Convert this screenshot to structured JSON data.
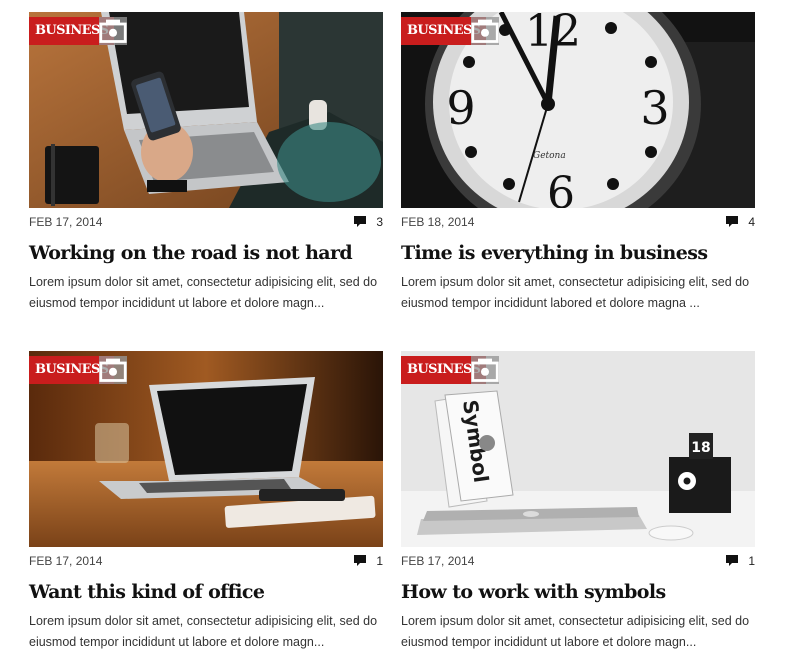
{
  "posts": [
    {
      "category": "BUSINESS",
      "date": "FEB 17, 2014",
      "comments": "3",
      "title": "Working on the road is not hard",
      "excerpt": "Lorem ipsum dolor sit amet, consectetur adipisicing elit, sed do eiusmod tempor incididunt ut labore et dolore magn..."
    },
    {
      "category": "BUSINESS",
      "date": "FEB 18, 2014",
      "comments": "4",
      "title": "Time is everything in business",
      "excerpt": "Lorem ipsum dolor sit amet, consectetur adipisicing elit, sed do eiusmod tempor incididunt labored et dolore magna ..."
    },
    {
      "category": "BUSINESS",
      "date": "FEB 17, 2014",
      "comments": "1",
      "title": "Want this kind of office",
      "excerpt": "Lorem ipsum dolor sit amet, consectetur adipisicing elit, sed do eiusmod tempor incididunt ut labore et dolore magn..."
    },
    {
      "category": "BUSINESS",
      "date": "FEB 17, 2014",
      "comments": "1",
      "title": "How to work with symbols",
      "excerpt": "Lorem ipsum dolor sit amet, consectetur adipisicing elit, sed do eiusmod tempor incididunt ut labore et dolore magn..."
    }
  ],
  "images": {
    "clock_numbers": [
      "12",
      "3",
      "6",
      "9"
    ],
    "clock_brand": "Getona",
    "book_title": "Symbol",
    "calendar_day": "18"
  },
  "colors": {
    "badge": "#c91d1d",
    "format_icon_bg": "#969696"
  }
}
